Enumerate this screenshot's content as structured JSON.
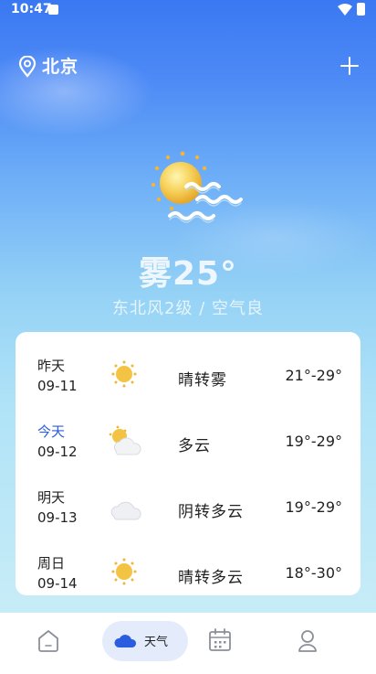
{
  "status": {
    "time": "10:47"
  },
  "header": {
    "city": "北京"
  },
  "current": {
    "temp": "雾25°",
    "wind": "东北风2级 / 空气良"
  },
  "forecast": [
    {
      "day": "昨天",
      "date": "09-11",
      "icon": "sun-icon",
      "condition": "晴转雾",
      "range": "21°-29°"
    },
    {
      "day": "今天",
      "date": "09-12",
      "icon": "partly-cloudy-icon",
      "condition": "多云",
      "range": "19°-29°"
    },
    {
      "day": "明天",
      "date": "09-13",
      "icon": "cloud-icon",
      "condition": "阴转多云",
      "range": "19°-29°"
    },
    {
      "day": "周日",
      "date": "09-14",
      "icon": "sun-icon",
      "condition": "晴转多云",
      "range": "18°-30°"
    }
  ],
  "nav": {
    "weather_label": "天气"
  },
  "colors": {
    "accent": "#2b5de0",
    "nav_pill": "#e4ecfb"
  }
}
